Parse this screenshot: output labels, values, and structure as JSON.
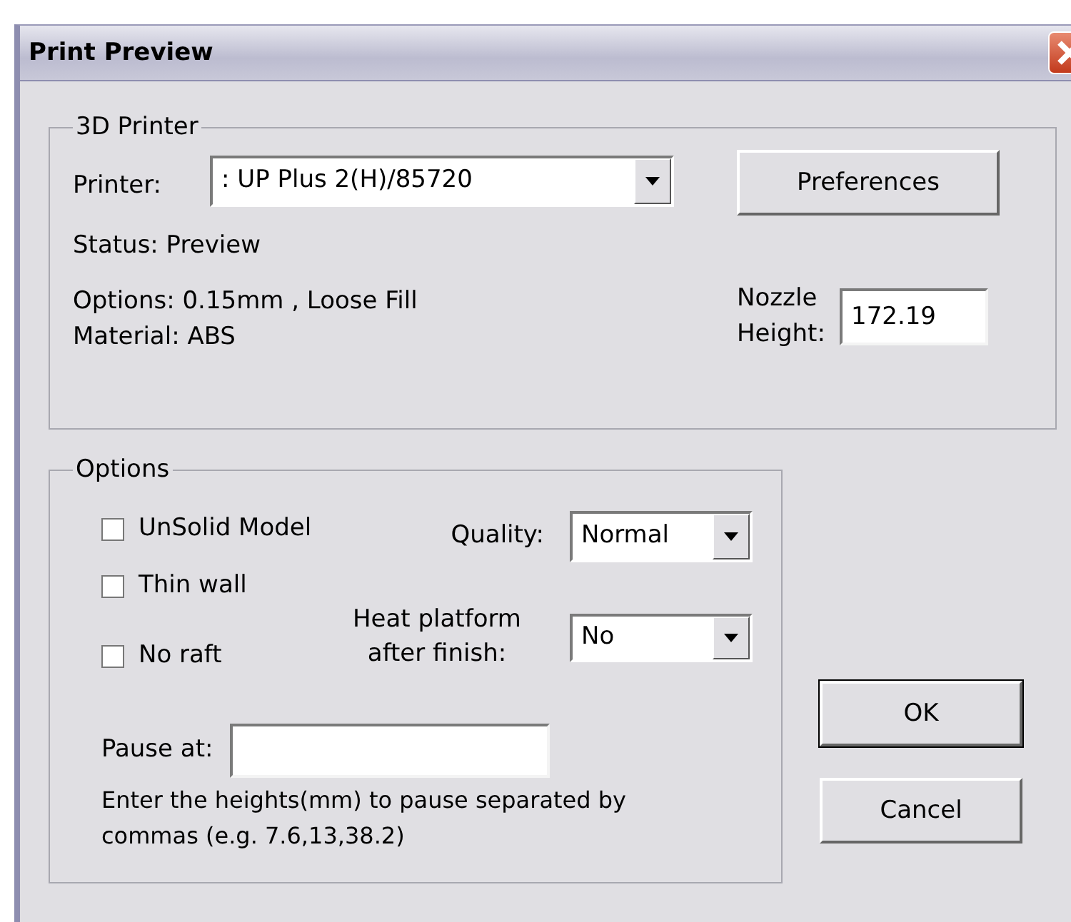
{
  "window": {
    "title": "Print Preview"
  },
  "printer_group": {
    "title": "3D Printer",
    "printer_label": "Printer:",
    "printer_value": ": UP Plus 2(H)/85720",
    "preferences_button": "Preferences",
    "status": "Status: Preview",
    "options_text": "Options: 0.15mm , Loose Fill",
    "material": "Material: ABS",
    "nozzle_label": "Nozzle Height:",
    "nozzle_value": "172.19"
  },
  "options_group": {
    "title": "Options",
    "checkboxes": [
      {
        "label": "UnSolid Model",
        "checked": false
      },
      {
        "label": "Thin wall",
        "checked": false
      },
      {
        "label": "No raft",
        "checked": false
      }
    ],
    "quality": {
      "label": "Quality:",
      "value": "Normal"
    },
    "heat_platform": {
      "label": "Heat platform after finish:",
      "value": "No"
    },
    "pause": {
      "label": "Pause at:"
    },
    "hint": "Enter the heights(mm) to pause separated by commas (e.g. 7.6,13,38.2)"
  },
  "buttons": [
    "OK",
    "Cancel"
  ]
}
